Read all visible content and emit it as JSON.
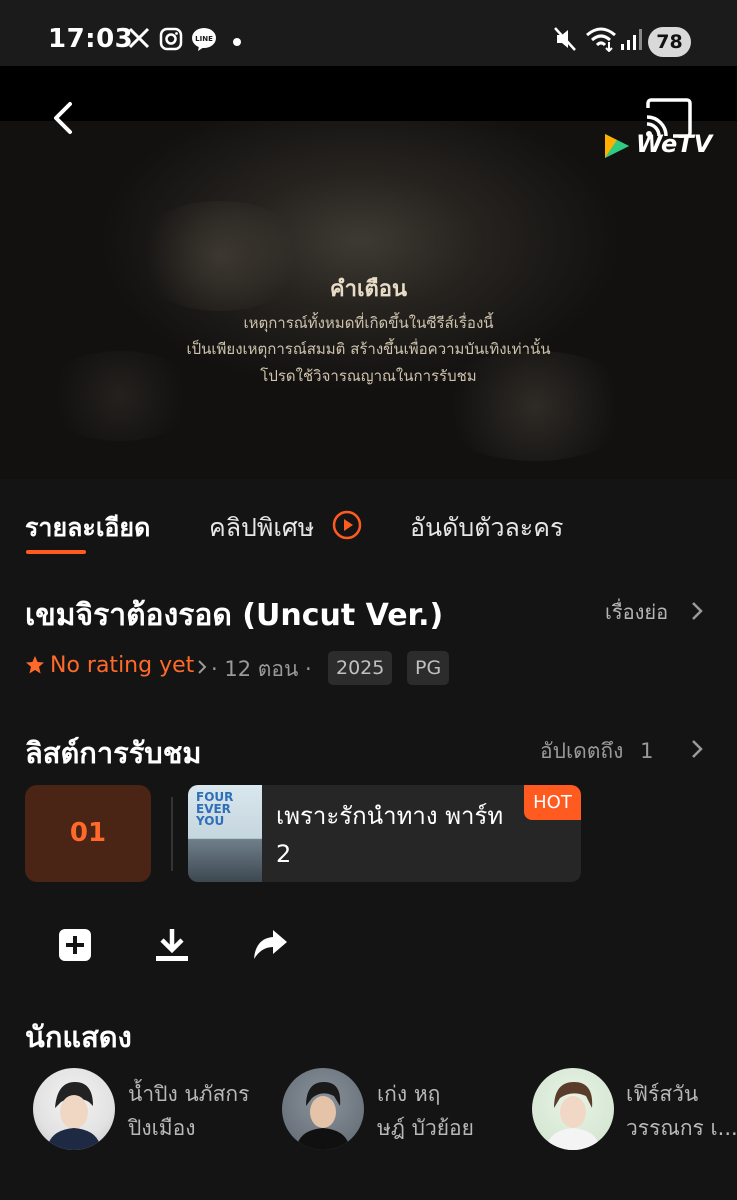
{
  "status_bar": {
    "time": "17:03",
    "apps": [
      "x-icon",
      "instagram-icon",
      "line-icon"
    ],
    "battery": "78"
  },
  "player": {
    "warning_title": "คำเตือน",
    "warning_lines": [
      "เหตุการณ์ทั้งหมดที่เกิดขึ้นในซีรีส์เรื่องนี้",
      "เป็นเพียงเหตุการณ์สมมติ สร้างขึ้นเพื่อความบันเทิงเท่านั้น",
      "โปรดใช้วิจารณญาณในการรับชม"
    ],
    "logo_text": "WeTV"
  },
  "tabs": [
    {
      "label": "รายละเอียด",
      "active": true
    },
    {
      "label": "คลิปพิเศษ",
      "active": false
    },
    {
      "label": "อันดับตัวละคร",
      "active": false
    }
  ],
  "show": {
    "title": "เขมจิราต้องรอด (Uncut Ver.)",
    "synopsis_link": "เรื่องย่อ",
    "rating": "No rating yet",
    "episodes": "· 12 ตอน ·",
    "year": "2025",
    "age_rating": "PG"
  },
  "watch_list": {
    "title": "ลิสต์การรับชม",
    "update_label": "อัปเดตถึง",
    "update_count": "1",
    "episode_number": "01",
    "recommended": {
      "thumb_text": "FOUR EVER YOU",
      "title": "เพราะรักนำทาง พาร์ท 2",
      "badge": "HOT"
    }
  },
  "actions": [
    "add-icon",
    "download-icon",
    "share-icon"
  ],
  "cast": {
    "title": "นักแสดง",
    "actors": [
      {
        "first": "น้ำปิง นภัสกร",
        "last": "ปิงเมือง"
      },
      {
        "first": "เก่ง หฤ",
        "last": "ษฎ์ บัวย้อย"
      },
      {
        "first": "เฟิร์สวัน",
        "last": "วรรณกร เ..."
      }
    ]
  },
  "colors": {
    "accent": "#ff5a1f",
    "background": "#141414"
  }
}
